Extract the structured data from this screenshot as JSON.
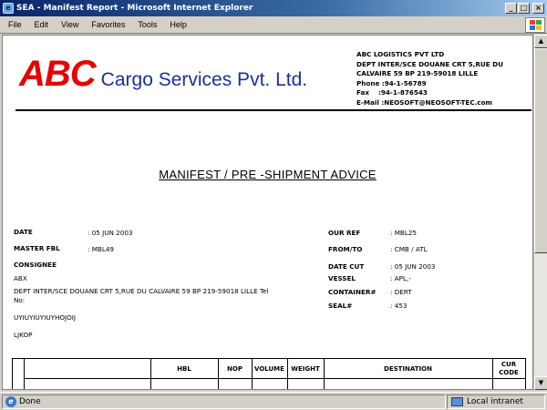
{
  "window": {
    "title": "SEA - Manifest Report - Microsoft Internet Explorer",
    "controls": {
      "minimize": "_",
      "maximize": "□",
      "close": "×"
    }
  },
  "menu": [
    "File",
    "Edit",
    "View",
    "Favorites",
    "Tools",
    "Help"
  ],
  "report": {
    "logo": {
      "abc": "ABC",
      "name": "Cargo Services Pvt. Ltd."
    },
    "company": {
      "name": "ABC LOGISTICS PVT LTD",
      "address1": "DEPT INTER/SCE DOUANE CRT 5,RUE DU",
      "address2": "CALVAIRE 59 BP 219-59018 LILLE",
      "phone": "Phone :94-1-56789",
      "fax": "Fax    :94-1-876543",
      "email": "E-Mail :NEOSOFT@NEOSOFT-TEC.com"
    },
    "title": "MANIFEST / PRE -SHIPMENT ADVICE",
    "left": {
      "date_label": "DATE",
      "date_value": ": 05 JUN 2003",
      "master_fbl_label": "MASTER FBL",
      "master_fbl_value": ": MBL49",
      "consignee_label": "CONSIGNEE",
      "consignee_name": "ABX",
      "consignee_addr1": "DEPT INTER/SCE DOUANE CRT 5,RUE DU CALVAIRE 59 BP 219-59018 LILLE Tel",
      "consignee_addr2": "No:",
      "line3": "UYIUYIUYIUYHOJOIJ",
      "line4": "LJKOP"
    },
    "right": {
      "our_ref_label": "OUR REF",
      "our_ref_value": ": MBL25",
      "from_to_label": "FROM/TO",
      "from_to_value": ": CMB / ATL",
      "date_cut_label": "DATE CUT",
      "date_cut_value": ": 05 JUN 2003",
      "vessel_label": "VESSEL",
      "vessel_value": ": APL,-",
      "container_label": "CONTAINER#",
      "container_value": ": DERT",
      "seal_label": "SEAL#",
      "seal_value": ": 453"
    },
    "table_headers": {
      "hbl": "HBL",
      "nop": "NOP",
      "volume": "VOLUME",
      "weight": "WEIGHT",
      "destination": "DESTINATION",
      "cur": "CUR",
      "code": "CODE"
    }
  },
  "status": {
    "text": "Done",
    "zone": "Local intranet"
  },
  "scrollbar": {
    "up": "▲",
    "down": "▼"
  }
}
